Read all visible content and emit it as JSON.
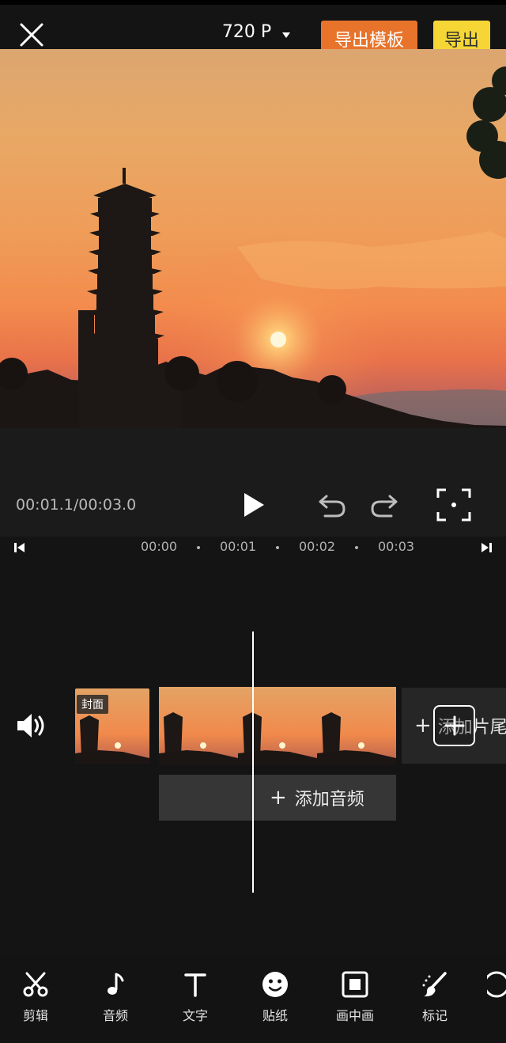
{
  "topbar": {
    "close_icon": "close-icon",
    "resolution": "720 P",
    "export_template_label": "导出模板",
    "export_label": "导出",
    "export_template_color": "#e8742c",
    "export_color": "#f6d634"
  },
  "player": {
    "time_readout": "00:01.1/00:03.0",
    "play_icon": "play-icon",
    "undo_icon": "undo-icon",
    "redo_icon": "redo-icon",
    "fullscreen_icon": "fullscreen-icon"
  },
  "ruler": {
    "ticks": [
      "00:00",
      "00:01",
      "00:02",
      "00:03"
    ]
  },
  "timeline": {
    "cover_label": "封面",
    "add_tail_label": "添加片尾",
    "add_audio_label": "添加音频",
    "volume_icon": "volume-icon"
  },
  "toolbar": {
    "items": [
      {
        "label": "剪辑",
        "icon": "scissors-icon"
      },
      {
        "label": "音频",
        "icon": "music-note-icon"
      },
      {
        "label": "文字",
        "icon": "text-icon"
      },
      {
        "label": "贴纸",
        "icon": "smiley-icon"
      },
      {
        "label": "画中画",
        "icon": "picture-in-picture-icon"
      },
      {
        "label": "标记",
        "icon": "brush-icon"
      }
    ]
  }
}
